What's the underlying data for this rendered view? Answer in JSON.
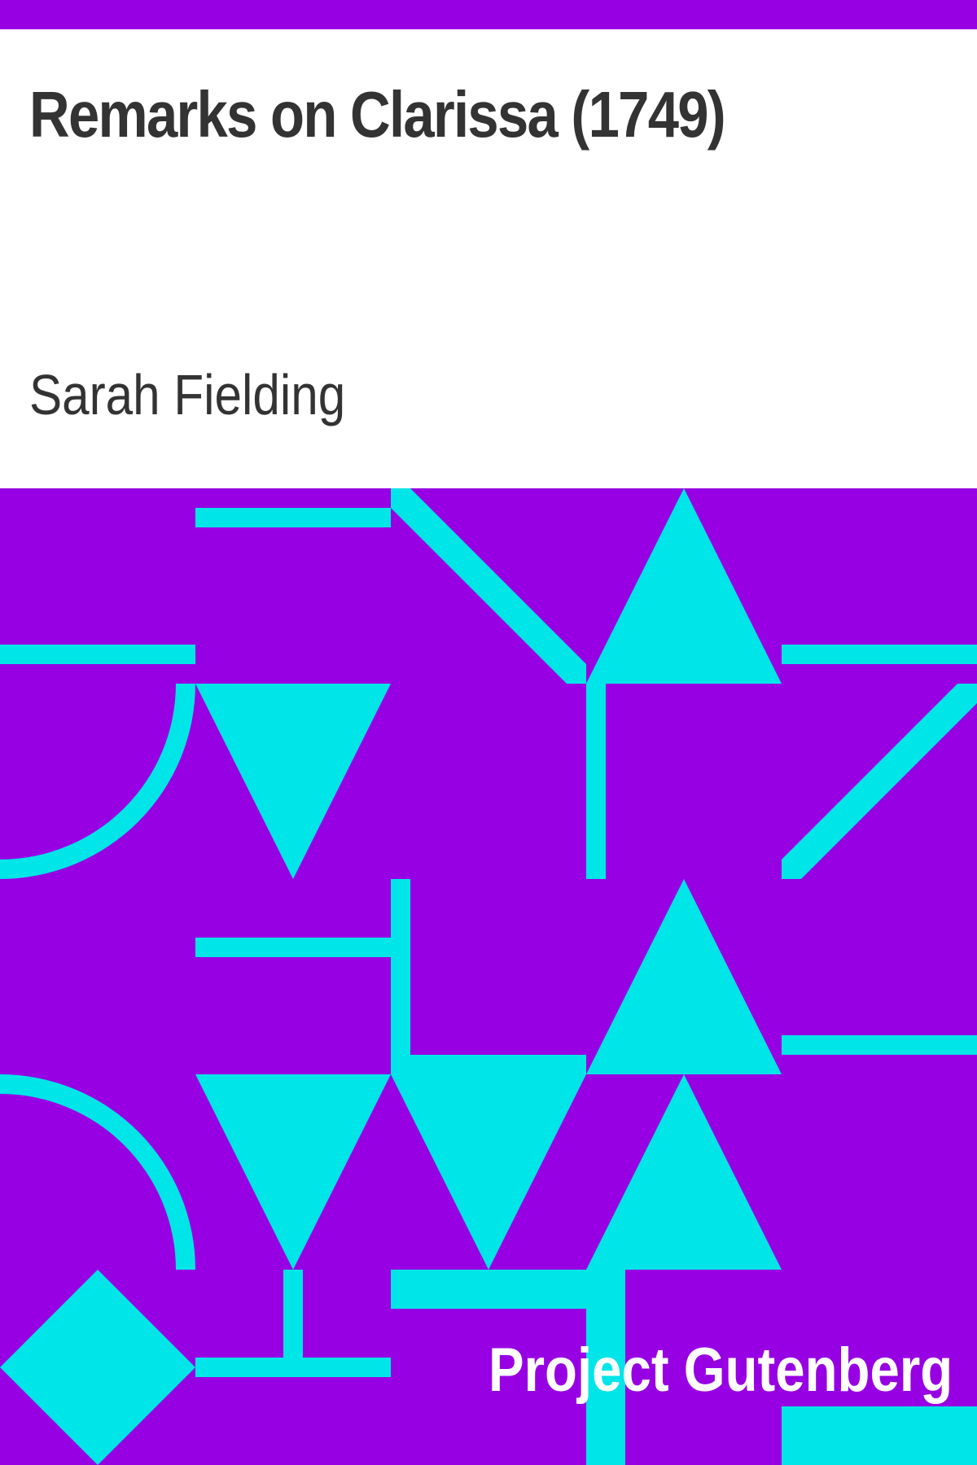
{
  "cover": {
    "title": "Remarks on Clarissa (1749)",
    "author": "Sarah Fielding",
    "publisher": "Project Gutenberg"
  },
  "colors": {
    "background": "#9700e3",
    "pattern": "#00e5e8",
    "title_text": "#333333",
    "publisher_text": "#ffffff",
    "title_area": "#ffffff"
  },
  "pattern_shapes": [
    "bar",
    "diagonal-band",
    "triangle-up",
    "triangle-down",
    "quarter-ring",
    "t-junction",
    "diamond"
  ]
}
